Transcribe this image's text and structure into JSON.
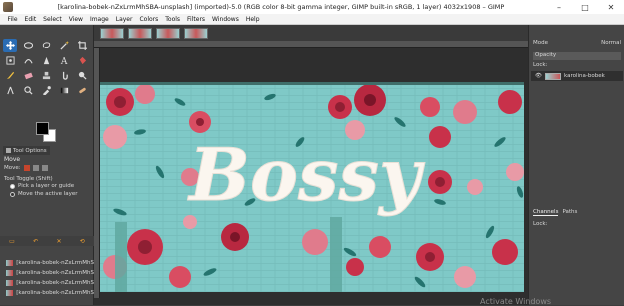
{
  "window": {
    "title": "[karolina-bobek-nZxLrmMhSBA-unsplash] (imported)-5.0 (RGB color 8-bit gamma integer, GIMP built-in sRGB, 1 layer) 4032x1908 – GIMP",
    "minimize": "–",
    "maximize": "□",
    "close": "✕"
  },
  "menu": [
    "File",
    "Edit",
    "Select",
    "View",
    "Image",
    "Layer",
    "Colors",
    "Tools",
    "Filters",
    "Windows",
    "Help"
  ],
  "tool_options": {
    "tab_label": "Tool Options",
    "title": "Move",
    "move_label": "Move:",
    "toggle_label": "Tool Toggle  (Shift)",
    "radio_pick": "Pick a layer or guide",
    "radio_move": "Move the active layer"
  },
  "images": {
    "rows": [
      "[karolina-bobek-nZxLrmMhS",
      "[karolina-bobek-nZxLrmMhS",
      "[karolina-bobek-nZxLrmMhS",
      "[karolina-bobek-nZxLrmMhS"
    ]
  },
  "layers": {
    "mode_label": "Mode",
    "mode_value": "Normal",
    "opacity_label": "Opacity",
    "lock_label": "Lock:",
    "layer_name": "karolina-bobek",
    "tab_channels": "Channels",
    "tab_paths": "Paths",
    "lock_label_2": "Lock:"
  },
  "canvas": {
    "mural_text": "Bossy"
  },
  "watermark": "Activate Windows",
  "colors": {
    "accent": "#2a6cb3",
    "mural_bg": "#7cc7c6",
    "rose": "#c8314a"
  }
}
